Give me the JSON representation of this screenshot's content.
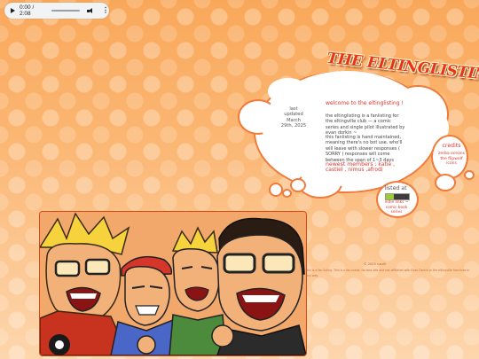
{
  "player": {
    "time": "0:00 / 2:08",
    "progress": 0.0,
    "icons": [
      "play-icon",
      "volume-icon",
      "more-vert-icon"
    ]
  },
  "site": {
    "logo_text": "THE ELTINGLISTING",
    "updated": {
      "line1": "last",
      "line2": "updated",
      "line3": "March",
      "line4": "29th, 2025"
    },
    "welcome_prefix": "welcome to the",
    "welcome_name": "eltinglisting !",
    "para1": "the eltinglisting is a fanlisting for the eltingville club — a comic series and single pilot illustrated by evan dorkin ~",
    "para2": "this fanlisting is hand maintained, meaning there's no bot use. who'll will leave with slower responses ( SORRY ) responses will come between the span of 1~3 days",
    "newest_label": "newest members",
    "newest_list": ": katie , castiel , nimus ,afrodi",
    "credits_title": "credits",
    "credits_links": [
      "zerba oceans",
      "the flipwolf",
      "icons"
    ],
    "listed_title": "listed at",
    "listed_links": [
      "indie links ~",
      "comic book series"
    ],
    "footer1": "© 2025 r.aulii",
    "footer2": "this is a fan listing. This is a fan-made, for-fans site and not affiliated with Evan Dorkin or the eltingville franchise in any way."
  },
  "colors": {
    "accent": "#e0362c",
    "bg_top": "#f9a85a",
    "bg_bottom": "#fdd6ad",
    "cloud_border": "#f07b3c"
  }
}
